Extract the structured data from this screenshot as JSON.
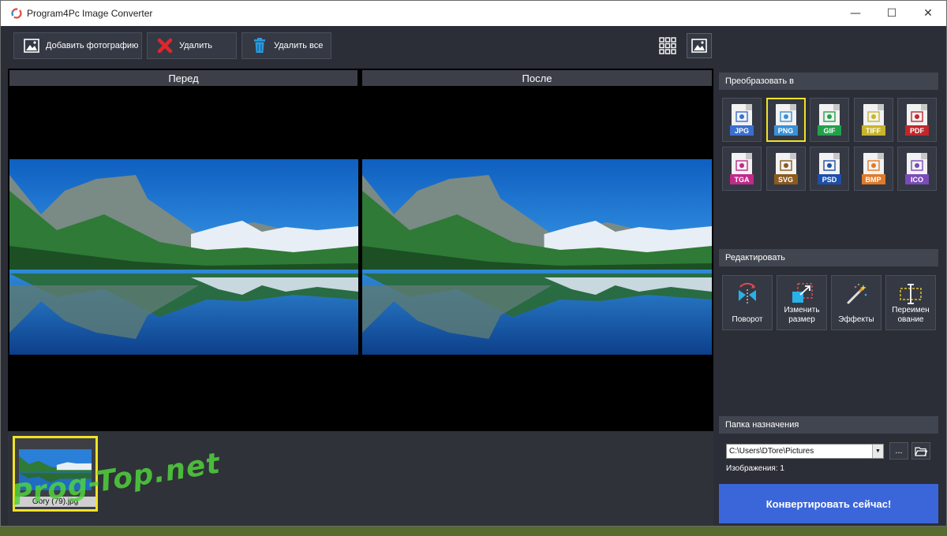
{
  "window": {
    "title": "Program4Pc Image Converter"
  },
  "window_controls": {
    "minimize": "—",
    "maximize": "☐",
    "close": "✕"
  },
  "toolbar": {
    "add_label": "Добавить фотографию",
    "delete_label": "Удалить",
    "delete_all_label": "Удалить все"
  },
  "preview": {
    "before_label": "Перед",
    "after_label": "После"
  },
  "thumbnails": [
    {
      "name": "Gory (79).jpg"
    }
  ],
  "watermark": "Prog-Top.net",
  "convert_to": {
    "title": "Преобразовать в",
    "formats": [
      {
        "label": "JPG",
        "color": "#3a6fd0",
        "selected": false
      },
      {
        "label": "PNG",
        "color": "#3a90d8",
        "selected": true
      },
      {
        "label": "GIF",
        "color": "#21a24a",
        "selected": false
      },
      {
        "label": "TIFF",
        "color": "#c8b52a",
        "selected": false
      },
      {
        "label": "PDF",
        "color": "#c0272d",
        "selected": false
      },
      {
        "label": "TGA",
        "color": "#c02a8a",
        "selected": false
      },
      {
        "label": "SVG",
        "color": "#8a5a1e",
        "selected": false
      },
      {
        "label": "PSD",
        "color": "#1e4fa8",
        "selected": false
      },
      {
        "label": "BMP",
        "color": "#e07a2a",
        "selected": false
      },
      {
        "label": "ICO",
        "color": "#7a4bb8",
        "selected": false
      }
    ]
  },
  "edit": {
    "title": "Редактировать",
    "rotate_label": "Поворот",
    "resize_label": "Изменить размер",
    "resize_line1": "Изменить",
    "resize_line2": "размер",
    "effects_label": "Эффекты",
    "rename_line1": "Переимен",
    "rename_line2": "ование"
  },
  "destination": {
    "title": "Папка назначения",
    "path": "C:\\Users\\DTore\\Pictures",
    "browse_label": "...",
    "images_count": "Изображения: 1"
  },
  "convert_button": "Конвертировать сейчас!",
  "colors": {
    "accent": "#3b66d9",
    "selection": "#f0e326",
    "panel": "#2b2e36"
  }
}
